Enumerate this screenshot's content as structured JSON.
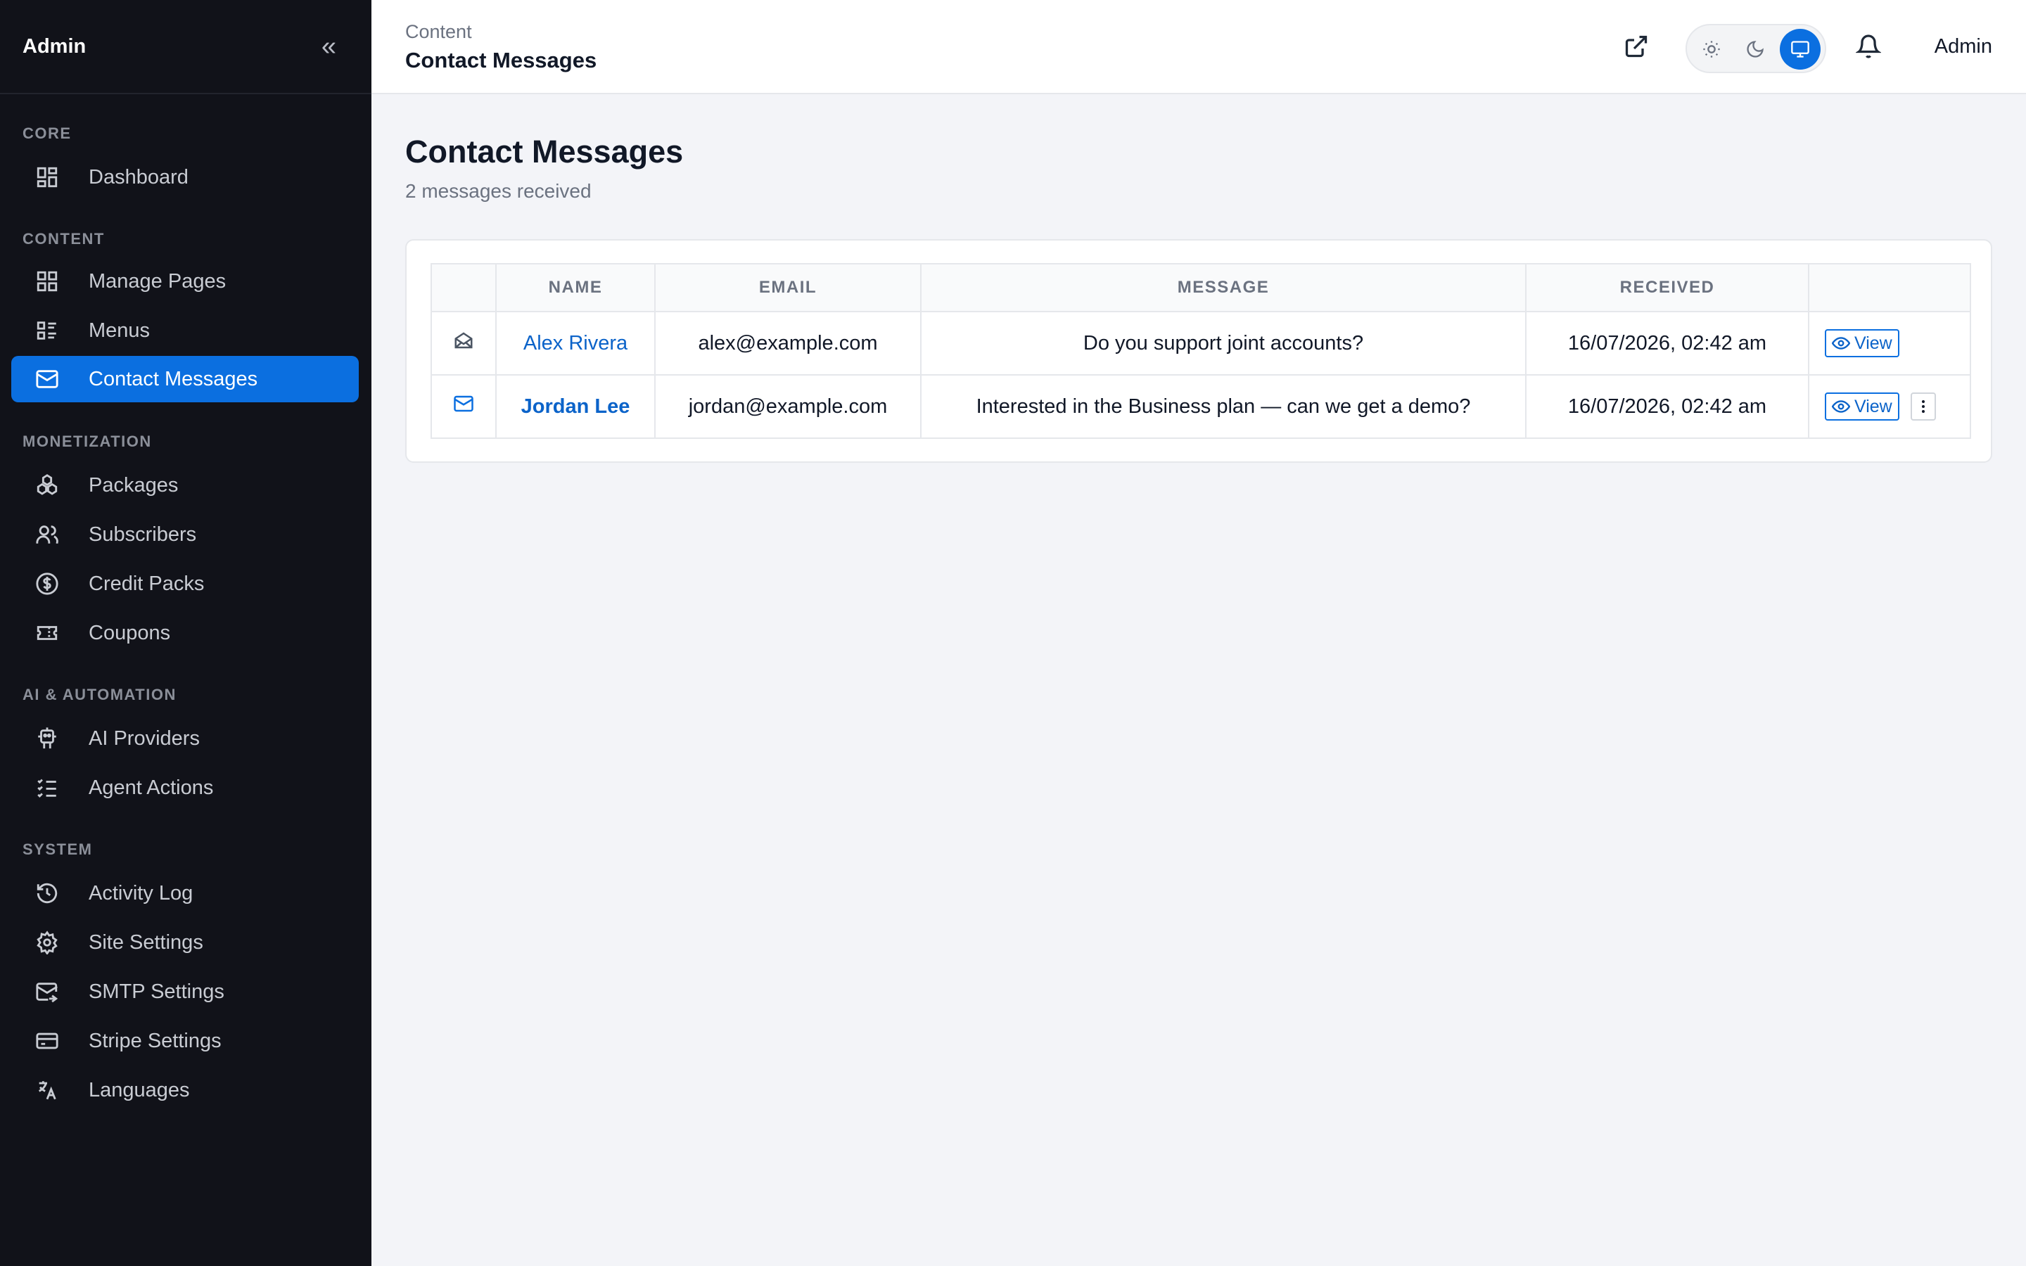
{
  "sidebar": {
    "brand": "Admin",
    "collapse_icon": "chevrons-left-icon",
    "sections": [
      {
        "title": "CORE"
      },
      {
        "title": "CONTENT"
      },
      {
        "title": "MONETIZATION"
      },
      {
        "title": "AI & AUTOMATION"
      },
      {
        "title": "SYSTEM"
      }
    ],
    "items": [
      {
        "label": "Dashboard",
        "icon": "dashboard-grid-icon"
      },
      {
        "label": "Manage Pages",
        "icon": "pages-grid-icon"
      },
      {
        "label": "Menus",
        "icon": "menu-list-icon"
      },
      {
        "label": "Contact Messages",
        "icon": "mail-icon",
        "active": true
      },
      {
        "label": "Packages",
        "icon": "packages-icon"
      },
      {
        "label": "Subscribers",
        "icon": "users-icon"
      },
      {
        "label": "Credit Packs",
        "icon": "dollar-circle-icon"
      },
      {
        "label": "Coupons",
        "icon": "ticket-icon"
      },
      {
        "label": "AI Providers",
        "icon": "bot-icon"
      },
      {
        "label": "Agent Actions",
        "icon": "checklist-icon"
      },
      {
        "label": "Activity Log",
        "icon": "history-icon"
      },
      {
        "label": "Site Settings",
        "icon": "gear-icon"
      },
      {
        "label": "SMTP Settings",
        "icon": "mail-send-icon"
      },
      {
        "label": "Stripe Settings",
        "icon": "credit-card-icon"
      },
      {
        "label": "Languages",
        "icon": "translate-icon"
      }
    ]
  },
  "header": {
    "breadcrumb_parent": "Content",
    "breadcrumb_current": "Contact Messages",
    "theme_options": [
      "light",
      "dark",
      "system"
    ],
    "theme_selected": "system",
    "user": "Admin"
  },
  "main": {
    "title": "Contact Messages",
    "subtitle": "2 messages received",
    "table": {
      "columns": [
        "",
        "NAME",
        "EMAIL",
        "MESSAGE",
        "RECEIVED",
        ""
      ],
      "rows": [
        {
          "status_icon": "mail-open-icon",
          "read": true,
          "name": "Alex Rivera",
          "email": "alex@example.com",
          "message": "Do you support joint accounts?",
          "received": "16/07/2026, 02:42 am",
          "view_label": "View"
        },
        {
          "status_icon": "mail-icon",
          "read": false,
          "name": "Jordan Lee",
          "email": "jordan@example.com",
          "message": "Interested in the Business plan — can we get a demo?",
          "received": "16/07/2026, 02:42 am",
          "view_label": "View"
        }
      ]
    }
  },
  "colors": {
    "sidebar_bg": "#111219",
    "accent": "#0b6fe0",
    "link": "#0b63c9",
    "page_bg": "#f3f4f8"
  }
}
